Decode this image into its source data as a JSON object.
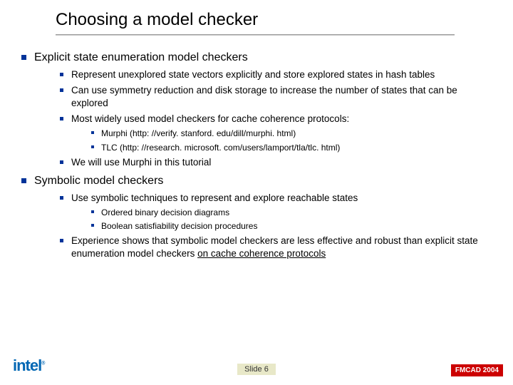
{
  "title": "Choosing a model checker",
  "bullets": {
    "b1": "Explicit state enumeration model checkers",
    "b1_1": "Represent unexplored state vectors explicitly and store explored states in hash tables",
    "b1_2": "Can use symmetry reduction and disk storage to increase the number of states that can be explored",
    "b1_3": "Most widely used model checkers for cache coherence protocols:",
    "b1_3_1": "Murphi (http: //verify. stanford. edu/dill/murphi. html)",
    "b1_3_2": "TLC (http: //research. microsoft. com/users/lamport/tla/tlc. html)",
    "b1_4": "We will use Murphi in this tutorial",
    "b2": "Symbolic model checkers",
    "b2_1": "Use symbolic techniques to represent and explore reachable states",
    "b2_1_1": "Ordered binary decision diagrams",
    "b2_1_2": "Boolean satisfiability decision procedures",
    "b2_2a": "Experience shows that symbolic model checkers are less effective and robust than explicit state enumeration model checkers ",
    "b2_2b": "on cache coherence protocols"
  },
  "footer": {
    "logo": "intel",
    "logo_sub": "®",
    "slide": "Slide 6",
    "badge": "FMCAD 2004"
  }
}
